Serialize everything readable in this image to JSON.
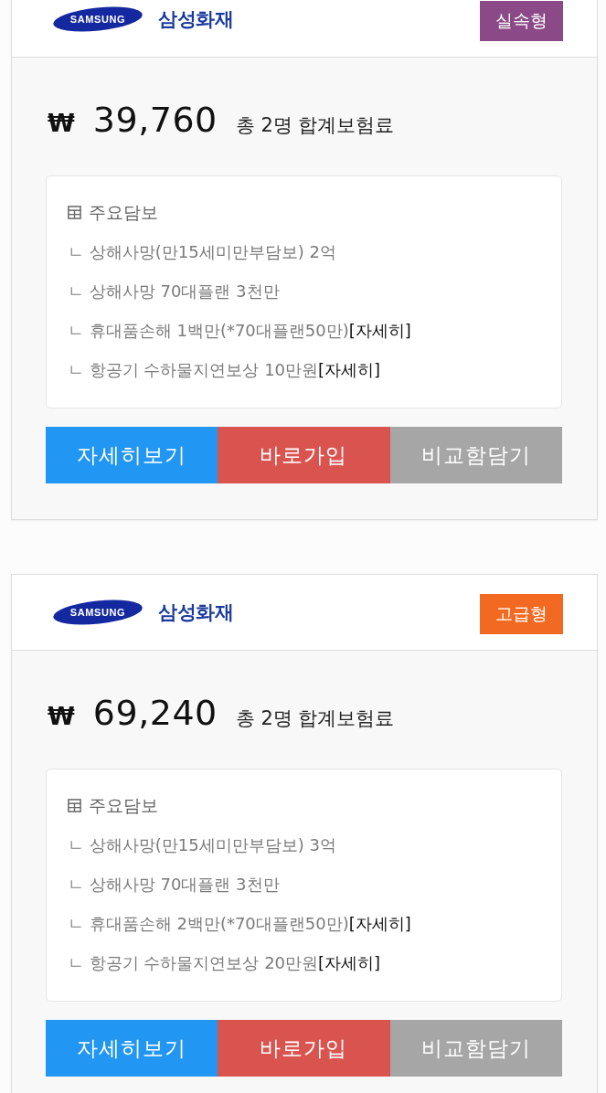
{
  "cards": [
    {
      "logo_text": "SAMSUNG",
      "company": "삼성화재",
      "badge": {
        "label": "실속형",
        "color": "#8b4a87"
      },
      "currency": "₩",
      "price": "39,760",
      "price_note": "총 2명 합계보험료",
      "coverage": {
        "title": "주요담보",
        "items": [
          {
            "text": "ㄴ 상해사망(만15세미만부담보) 2억"
          },
          {
            "text": "ㄴ 상해사망 70대플랜 3천만"
          },
          {
            "text": "ㄴ 휴대품손해 1백만(*70대플랜50만)",
            "link": "[자세히]"
          },
          {
            "text": "ㄴ 항공기 수하물지연보상 10만원",
            "link": "[자세히]"
          }
        ]
      },
      "buttons": [
        {
          "label": "자세히보기",
          "kind": "detail"
        },
        {
          "label": "바로가입",
          "kind": "join"
        },
        {
          "label": "비교함담기",
          "kind": "compare"
        }
      ]
    },
    {
      "logo_text": "SAMSUNG",
      "company": "삼성화재",
      "badge": {
        "label": "고급형",
        "color": "#f26a21"
      },
      "currency": "₩",
      "price": "69,240",
      "price_note": "총 2명 합계보험료",
      "coverage": {
        "title": "주요담보",
        "items": [
          {
            "text": "ㄴ 상해사망(만15세미만부담보) 3억"
          },
          {
            "text": "ㄴ 상해사망 70대플랜 3천만"
          },
          {
            "text": "ㄴ 휴대품손해 2백만(*70대플랜50만)",
            "link": "[자세히]"
          },
          {
            "text": "ㄴ 항공기 수하물지연보상 20만원",
            "link": "[자세히]"
          }
        ]
      },
      "buttons": [
        {
          "label": "자세히보기",
          "kind": "detail"
        },
        {
          "label": "바로가입",
          "kind": "join"
        },
        {
          "label": "비교함담기",
          "kind": "compare"
        }
      ]
    }
  ]
}
